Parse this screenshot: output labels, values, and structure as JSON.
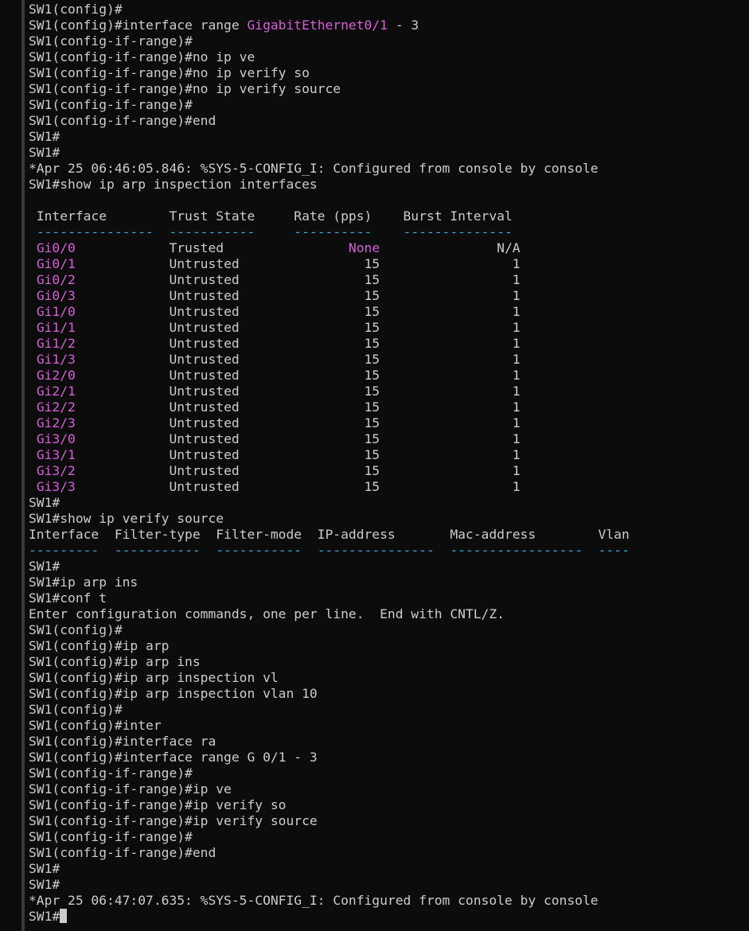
{
  "terminal": {
    "lines": [
      [
        {
          "t": "SW1(config)#"
        }
      ],
      [
        {
          "t": "SW1(config)#interface range "
        },
        {
          "t": "GigabitEthernet0/1",
          "c": "magenta"
        },
        {
          "t": " - 3"
        }
      ],
      [
        {
          "t": "SW1(config-if-range)#"
        }
      ],
      [
        {
          "t": "SW1(config-if-range)#no ip ve"
        }
      ],
      [
        {
          "t": "SW1(config-if-range)#no ip verify so"
        }
      ],
      [
        {
          "t": "SW1(config-if-range)#no ip verify source"
        }
      ],
      [
        {
          "t": "SW1(config-if-range)#"
        }
      ],
      [
        {
          "t": "SW1(config-if-range)#end"
        }
      ],
      [
        {
          "t": "SW1#"
        }
      ],
      [
        {
          "t": "SW1#"
        }
      ],
      [
        {
          "t": "*Apr 25 06:46:05.846: %SYS-5-CONFIG_I: Configured from console by console"
        }
      ],
      [
        {
          "t": "SW1#show ip arp inspection interfaces"
        }
      ],
      [
        {
          "t": ""
        }
      ],
      [
        {
          "t": " Interface        Trust State     Rate (pps)    Burst Interval"
        }
      ],
      [
        {
          "t": " ---------------",
          "c": "cyan"
        },
        {
          "t": "  "
        },
        {
          "t": "-----------",
          "c": "cyan"
        },
        {
          "t": "     "
        },
        {
          "t": "----------",
          "c": "cyan"
        },
        {
          "t": "    "
        },
        {
          "t": "--------------",
          "c": "cyan"
        }
      ],
      [
        {
          "t": " "
        },
        {
          "t": "Gi0/0",
          "c": "magenta"
        },
        {
          "t": "            Trusted                "
        },
        {
          "t": "None",
          "c": "magenta"
        },
        {
          "t": "               N/A"
        }
      ],
      [
        {
          "t": " "
        },
        {
          "t": "Gi0/1",
          "c": "magenta"
        },
        {
          "t": "            Untrusted                15                 1"
        }
      ],
      [
        {
          "t": " "
        },
        {
          "t": "Gi0/2",
          "c": "magenta"
        },
        {
          "t": "            Untrusted                15                 1"
        }
      ],
      [
        {
          "t": " "
        },
        {
          "t": "Gi0/3",
          "c": "magenta"
        },
        {
          "t": "            Untrusted                15                 1"
        }
      ],
      [
        {
          "t": " "
        },
        {
          "t": "Gi1/0",
          "c": "magenta"
        },
        {
          "t": "            Untrusted                15                 1"
        }
      ],
      [
        {
          "t": " "
        },
        {
          "t": "Gi1/1",
          "c": "magenta"
        },
        {
          "t": "            Untrusted                15                 1"
        }
      ],
      [
        {
          "t": " "
        },
        {
          "t": "Gi1/2",
          "c": "magenta"
        },
        {
          "t": "            Untrusted                15                 1"
        }
      ],
      [
        {
          "t": " "
        },
        {
          "t": "Gi1/3",
          "c": "magenta"
        },
        {
          "t": "            Untrusted                15                 1"
        }
      ],
      [
        {
          "t": " "
        },
        {
          "t": "Gi2/0",
          "c": "magenta"
        },
        {
          "t": "            Untrusted                15                 1"
        }
      ],
      [
        {
          "t": " "
        },
        {
          "t": "Gi2/1",
          "c": "magenta"
        },
        {
          "t": "            Untrusted                15                 1"
        }
      ],
      [
        {
          "t": " "
        },
        {
          "t": "Gi2/2",
          "c": "magenta"
        },
        {
          "t": "            Untrusted                15                 1"
        }
      ],
      [
        {
          "t": " "
        },
        {
          "t": "Gi2/3",
          "c": "magenta"
        },
        {
          "t": "            Untrusted                15                 1"
        }
      ],
      [
        {
          "t": " "
        },
        {
          "t": "Gi3/0",
          "c": "magenta"
        },
        {
          "t": "            Untrusted                15                 1"
        }
      ],
      [
        {
          "t": " "
        },
        {
          "t": "Gi3/1",
          "c": "magenta"
        },
        {
          "t": "            Untrusted                15                 1"
        }
      ],
      [
        {
          "t": " "
        },
        {
          "t": "Gi3/2",
          "c": "magenta"
        },
        {
          "t": "            Untrusted                15                 1"
        }
      ],
      [
        {
          "t": " "
        },
        {
          "t": "Gi3/3",
          "c": "magenta"
        },
        {
          "t": "            Untrusted                15                 1"
        }
      ],
      [
        {
          "t": "SW1#"
        }
      ],
      [
        {
          "t": "SW1#show ip verify source"
        }
      ],
      [
        {
          "t": "Interface  Filter-type  Filter-mode  IP-address       Mac-address        Vlan"
        }
      ],
      [
        {
          "t": "---------",
          "c": "cyan"
        },
        {
          "t": "  "
        },
        {
          "t": "-----------",
          "c": "cyan"
        },
        {
          "t": "  "
        },
        {
          "t": "-----------",
          "c": "cyan"
        },
        {
          "t": "  "
        },
        {
          "t": "---------------",
          "c": "cyan"
        },
        {
          "t": "  "
        },
        {
          "t": "-----------------",
          "c": "cyan"
        },
        {
          "t": "  "
        },
        {
          "t": "----",
          "c": "cyan"
        }
      ],
      [
        {
          "t": "SW1#"
        }
      ],
      [
        {
          "t": "SW1#ip arp ins"
        }
      ],
      [
        {
          "t": "SW1#conf t"
        }
      ],
      [
        {
          "t": "Enter configuration commands, one per line.  End with CNTL/Z."
        }
      ],
      [
        {
          "t": "SW1(config)#"
        }
      ],
      [
        {
          "t": "SW1(config)#ip arp"
        }
      ],
      [
        {
          "t": "SW1(config)#ip arp ins"
        }
      ],
      [
        {
          "t": "SW1(config)#ip arp inspection vl"
        }
      ],
      [
        {
          "t": "SW1(config)#ip arp inspection vlan 10"
        }
      ],
      [
        {
          "t": "SW1(config)#"
        }
      ],
      [
        {
          "t": "SW1(config)#inter"
        }
      ],
      [
        {
          "t": "SW1(config)#interface ra"
        }
      ],
      [
        {
          "t": "SW1(config)#interface range G 0/1 - 3"
        }
      ],
      [
        {
          "t": "SW1(config-if-range)#"
        }
      ],
      [
        {
          "t": "SW1(config-if-range)#ip ve"
        }
      ],
      [
        {
          "t": "SW1(config-if-range)#ip verify so"
        }
      ],
      [
        {
          "t": "SW1(config-if-range)#ip verify source"
        }
      ],
      [
        {
          "t": "SW1(config-if-range)#"
        }
      ],
      [
        {
          "t": "SW1(config-if-range)#end"
        }
      ],
      [
        {
          "t": "SW1#"
        }
      ],
      [
        {
          "t": "SW1#"
        }
      ],
      [
        {
          "t": "*Apr 25 06:47:07.635: %SYS-5-CONFIG_I: Configured from console by console"
        }
      ],
      [
        {
          "t": "SW1#"
        }
      ]
    ],
    "colors": {
      "background": "#0c0c0c",
      "text": "#cccccc",
      "interface_highlight": "#d75fd7",
      "separator_dashes": "#3aa8d8",
      "cursor": "#cccccc"
    }
  }
}
